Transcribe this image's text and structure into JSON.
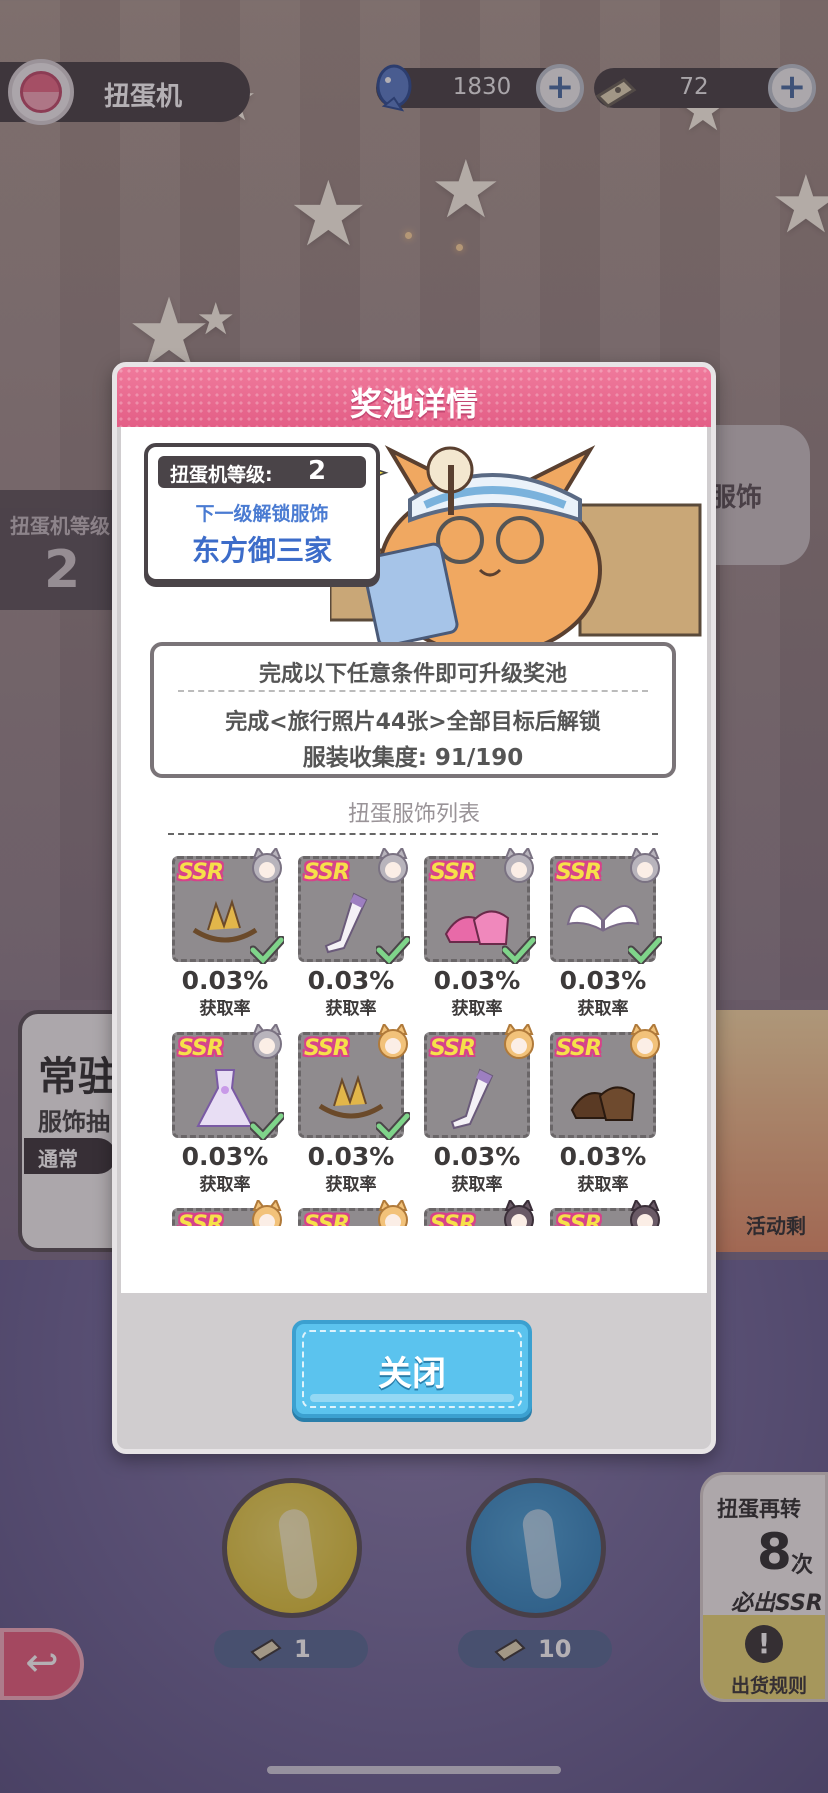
{
  "top_bar": {
    "title": "扭蛋机",
    "currencies": [
      {
        "icon": "fish-icon",
        "value": "1830"
      },
      {
        "icon": "ticket-icon",
        "value": "72"
      }
    ],
    "plus_label": "+"
  },
  "background": {
    "level_label": "扭蛋机等级",
    "level_value": "2",
    "right_label": "服饰",
    "card_title": "常驻",
    "card_subtitle": "服饰抽",
    "card_tag": "通常",
    "event_label": "活动剩"
  },
  "modal": {
    "title": "奖池详情",
    "level_label": "扭蛋机等级:",
    "level_value": "2",
    "next_unlock_label": "下一级解锁服饰",
    "next_unlock_name": "东方御三家",
    "condition_title": "完成以下任意条件即可升级奖池",
    "condition_text": "完成<旅行照片44张>全部目标后解锁",
    "collection_progress": "服装收集度: 91/190",
    "list_title": "扭蛋服饰列表",
    "rate_label": "获取率",
    "close_label": "关闭",
    "items": [
      {
        "rarity": "SSR",
        "rate": "0.03%",
        "owner": "gray-cat",
        "type": "tiara",
        "owned": true
      },
      {
        "rarity": "SSR",
        "rate": "0.03%",
        "owner": "gray-cat",
        "type": "stockings",
        "owned": true
      },
      {
        "rarity": "SSR",
        "rate": "0.03%",
        "owner": "gray-cat",
        "type": "shoes-pink",
        "owned": true
      },
      {
        "rarity": "SSR",
        "rate": "0.03%",
        "owner": "gray-cat",
        "type": "wings",
        "owned": true
      },
      {
        "rarity": "SSR",
        "rate": "0.03%",
        "owner": "gray-cat",
        "type": "dress",
        "owned": true
      },
      {
        "rarity": "SSR",
        "rate": "0.03%",
        "owner": "orange-cat",
        "type": "tiara",
        "owned": true
      },
      {
        "rarity": "SSR",
        "rate": "0.03%",
        "owner": "orange-cat",
        "type": "stockings",
        "owned": false
      },
      {
        "rarity": "SSR",
        "rate": "0.03%",
        "owner": "orange-cat",
        "type": "shoes-brown",
        "owned": false
      },
      {
        "rarity": "SSR",
        "rate": "",
        "owner": "orange-cat",
        "type": "",
        "owned": false
      },
      {
        "rarity": "SSR",
        "rate": "",
        "owner": "orange-cat",
        "type": "",
        "owned": false
      },
      {
        "rarity": "SSR",
        "rate": "",
        "owner": "dark-cat",
        "type": "",
        "owned": false
      },
      {
        "rarity": "SSR",
        "rate": "",
        "owner": "dark-cat",
        "type": "",
        "owned": false
      }
    ]
  },
  "bottom": {
    "single_cost": "1",
    "multi_cost": "10",
    "guarantee_line1": "扭蛋再转",
    "guarantee_count": "8",
    "guarantee_unit": "次",
    "guarantee_line2": "必出SSR",
    "rules_label": "出货规则",
    "rules_icon": "!"
  },
  "colors": {
    "accent_pink": "#e35e86",
    "close_blue": "#5bc3ee",
    "yellow_button": "#e2c83e",
    "blue_button": "#3b8ec4",
    "link_blue": "#3c6cc9"
  }
}
